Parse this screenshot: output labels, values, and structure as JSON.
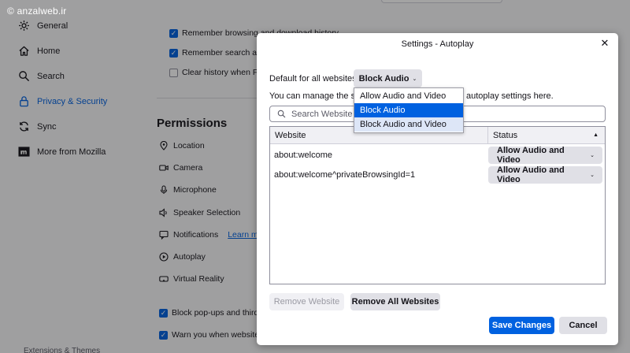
{
  "watermark": "© anzalweb.ir",
  "sidebar": {
    "items": [
      {
        "label": "General",
        "icon": "gear-icon"
      },
      {
        "label": "Home",
        "icon": "home-icon"
      },
      {
        "label": "Search",
        "icon": "search-icon"
      },
      {
        "label": "Privacy & Security",
        "icon": "lock-icon",
        "active": true
      },
      {
        "label": "Sync",
        "icon": "sync-icon"
      },
      {
        "label": "More from Mozilla",
        "icon": "mozilla-icon"
      }
    ],
    "footer_label": "Extensions & Themes"
  },
  "history": {
    "remember_browsing": "Remember browsing and download history",
    "remember_search": "Remember search and form history",
    "clear_history": "Clear history when Firefox closes"
  },
  "permissions": {
    "title": "Permissions",
    "items": [
      {
        "label": "Location",
        "icon": "location-icon"
      },
      {
        "label": "Camera",
        "icon": "camera-icon"
      },
      {
        "label": "Microphone",
        "icon": "microphone-icon"
      },
      {
        "label": "Speaker Selection",
        "icon": "speaker-icon"
      },
      {
        "label": "Notifications",
        "icon": "notification-icon",
        "link": "Learn more"
      },
      {
        "label": "Autoplay",
        "icon": "autoplay-icon"
      },
      {
        "label": "Virtual Reality",
        "icon": "vr-icon"
      }
    ],
    "block_popups": "Block pop-ups and third-party redirects",
    "warn_addons": "Warn you when websites try to install add-ons"
  },
  "dialog": {
    "title": "Settings - Autoplay",
    "close_glyph": "✕",
    "default_label": "Default for all websites:",
    "default_value": "Block Audio",
    "chevron_glyph": "⌄",
    "manage_text": "You can manage the site",
    "manage_tail": "autoplay settings here.",
    "search_placeholder": "Search Website",
    "columns": {
      "website": "Website",
      "status": "Status",
      "sort_glyph": "▲"
    },
    "rows": [
      {
        "site": "about:welcome",
        "status": "Allow Audio and Video"
      },
      {
        "site": "about:welcome^privateBrowsingId=1",
        "status": "Allow Audio and Video"
      }
    ],
    "remove_website": "Remove Website",
    "remove_all": "Remove All Websites",
    "save": "Save Changes",
    "cancel": "Cancel"
  },
  "dropdown": {
    "options": [
      {
        "label": "Allow Audio and Video",
        "state": "normal"
      },
      {
        "label": "Block Audio",
        "state": "selected"
      },
      {
        "label": "Block Audio and Video",
        "state": "hover"
      }
    ]
  },
  "colors": {
    "accent": "#0061e0",
    "hover": "#dde6f7",
    "button_gray": "#e0e0e6"
  }
}
